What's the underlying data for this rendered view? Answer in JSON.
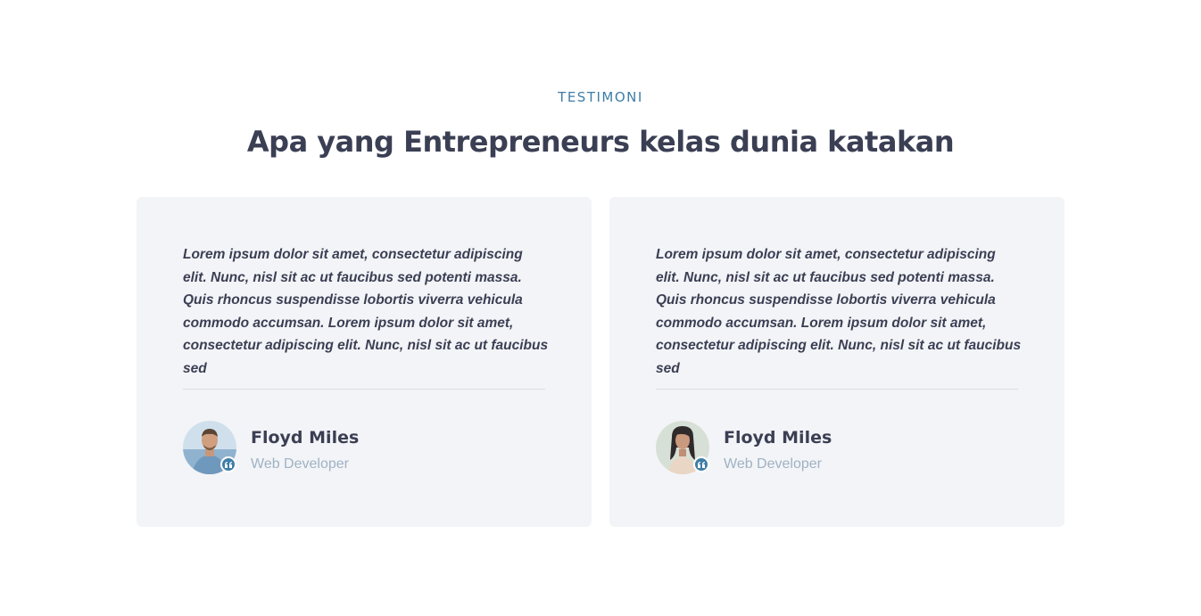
{
  "section": {
    "eyebrow": "TESTIMONI",
    "heading": "Apa yang Entrepreneurs kelas dunia katakan"
  },
  "testimonials": [
    {
      "quote": "Lorem ipsum dolor sit amet, consectetur adipiscing elit. Nunc, nisl sit ac ut faucibus sed potenti massa. Quis rhoncus suspendisse lobortis viverra vehicula commodo accumsan. Lorem ipsum dolor sit amet, consectetur adipiscing elit. Nunc, nisl sit ac ut faucibus sed",
      "name": "Floyd Miles",
      "role": "Web Developer",
      "avatar_icon": "avatar-man"
    },
    {
      "quote": "Lorem ipsum dolor sit amet, consectetur adipiscing elit. Nunc, nisl sit ac ut faucibus sed potenti massa. Quis rhoncus suspendisse lobortis viverra vehicula commodo accumsan. Lorem ipsum dolor sit amet, consectetur adipiscing elit. Nunc, nisl sit ac ut faucibus sed",
      "name": "Floyd Miles",
      "role": "Web Developer",
      "avatar_icon": "avatar-woman"
    }
  ],
  "colors": {
    "accent": "#3f7ea6",
    "heading": "#3b3f54",
    "card_bg": "#f3f4f7",
    "muted": "#9fb2c4"
  }
}
